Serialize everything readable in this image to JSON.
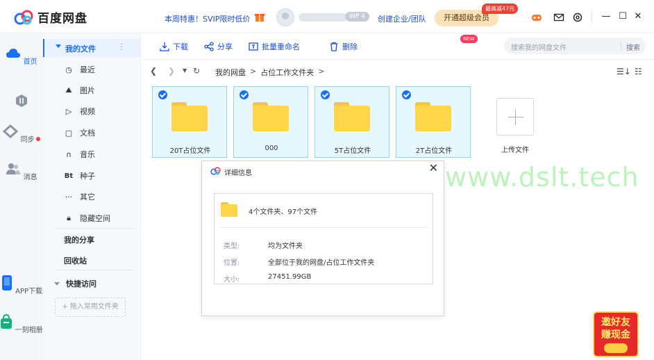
{
  "header": {
    "app_name": "百度网盘",
    "promo": "本周特惠！SVIP限时低价",
    "wp_badge": "WP 4",
    "enterprise_link": "创建企业/团队",
    "vip_button": "开通超级会员",
    "vip_tag": "最高减47元"
  },
  "rail": {
    "items": [
      {
        "label": "首页"
      },
      {
        "label": "同步"
      },
      {
        "label": "消息"
      },
      {
        "label": "APP下载"
      },
      {
        "label": "一刻相册"
      }
    ]
  },
  "sidebar": {
    "my_files": "我的文件",
    "categories": [
      {
        "label": "最近",
        "icon": "clock-icon"
      },
      {
        "label": "图片",
        "icon": "image-icon"
      },
      {
        "label": "视频",
        "icon": "video-icon"
      },
      {
        "label": "文档",
        "icon": "document-icon"
      },
      {
        "label": "音乐",
        "icon": "music-icon"
      },
      {
        "label": "种子",
        "icon": "torrent-icon"
      },
      {
        "label": "其它",
        "icon": "more-icon"
      },
      {
        "label": "隐藏空间",
        "icon": "lock-icon"
      }
    ],
    "my_share": "我的分享",
    "recycle_bin": "回收站",
    "quick_access": "快捷访问",
    "drop_hint": "+ 拖入常用文件夹"
  },
  "toolbar": {
    "download": "下载",
    "share": "分享",
    "batch_rename": "批量重命名",
    "delete": "删除",
    "new_badge": "NEW",
    "search_placeholder": "搜索我的网盘文件",
    "search_button": "搜索"
  },
  "breadcrumb": {
    "root": "我的网盘",
    "sep": ">",
    "current": "占位工作文件夹"
  },
  "files": [
    {
      "name": "20T占位文件",
      "selected": true
    },
    {
      "name": "000",
      "selected": true
    },
    {
      "name": "5T占位文件",
      "selected": true
    },
    {
      "name": "2T占位文件",
      "selected": true
    }
  ],
  "upload_label": "上传文件",
  "watermark": "东方体育  www.dslt.tech",
  "dialog": {
    "title": "详细信息",
    "summary": "4个文件夹、97个文件",
    "rows": [
      {
        "key": "类型:",
        "value": "均为文件夹"
      },
      {
        "key": "位置:",
        "value": "全部位于我的网盘/占位工作文件夹"
      },
      {
        "key": "大小:",
        "value": "27451.99GB"
      }
    ]
  },
  "invite": {
    "line1": "邀好友",
    "line2": "赚现金"
  },
  "colors": {
    "accent": "#1a70f5",
    "link": "#1a4ed8",
    "folder": "#ffd54a",
    "tile_bg": "#e6f7fd",
    "tile_border": "#8fd6f3"
  }
}
